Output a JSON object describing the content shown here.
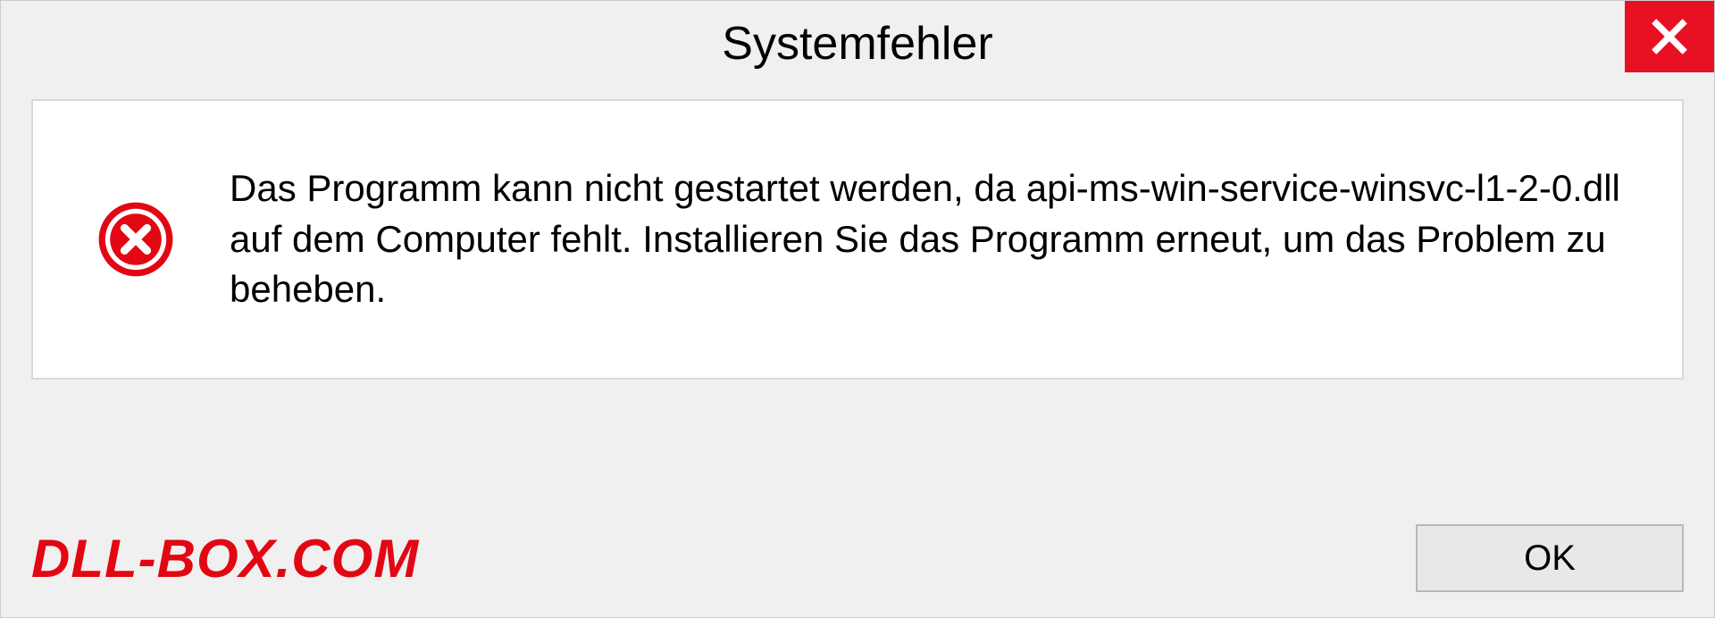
{
  "dialog": {
    "title": "Systemfehler",
    "message": "Das Programm kann nicht gestartet werden, da api-ms-win-service-winsvc-l1-2-0.dll auf dem Computer fehlt. Installieren Sie das Programm erneut, um das Problem zu beheben.",
    "ok_label": "OK"
  },
  "watermark": "DLL-BOX.COM"
}
